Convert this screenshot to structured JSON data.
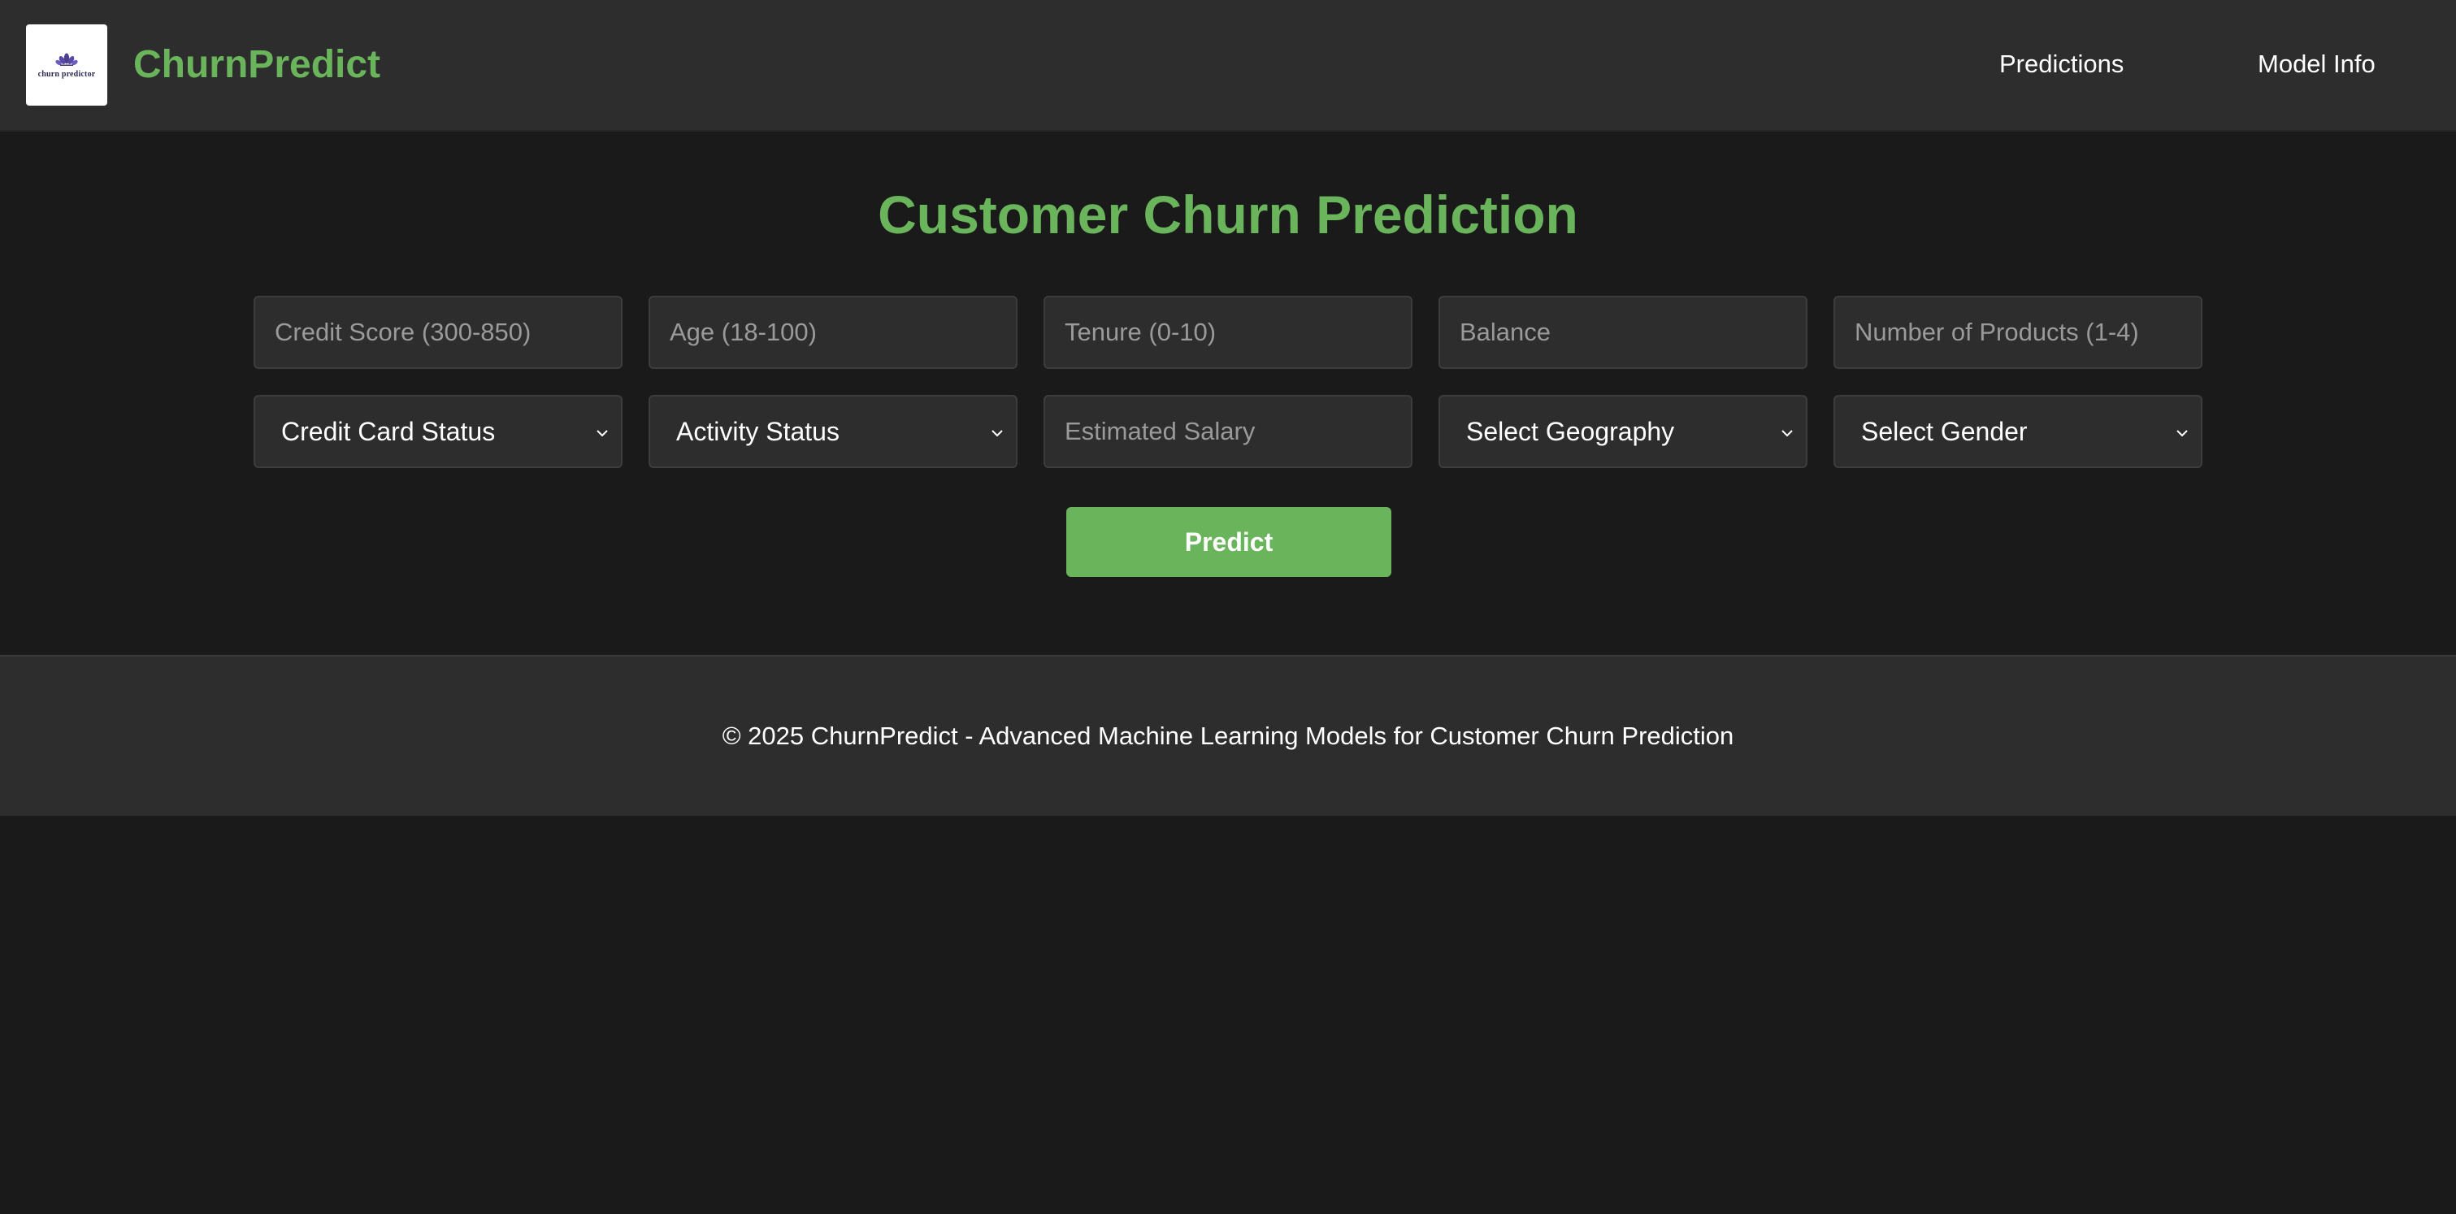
{
  "header": {
    "logo_text": "churn predictor",
    "brand": "ChurnPredict",
    "nav": {
      "predictions": "Predictions",
      "model_info": "Model Info"
    }
  },
  "main": {
    "title": "Customer Churn Prediction",
    "inputs": {
      "credit_score": {
        "placeholder": "Credit Score (300-850)",
        "value": ""
      },
      "age": {
        "placeholder": "Age (18-100)",
        "value": ""
      },
      "tenure": {
        "placeholder": "Tenure (0-10)",
        "value": ""
      },
      "balance": {
        "placeholder": "Balance",
        "value": ""
      },
      "num_products": {
        "placeholder": "Number of Products (1-4)",
        "value": ""
      },
      "estimated_salary": {
        "placeholder": "Estimated Salary",
        "value": ""
      }
    },
    "selects": {
      "credit_card_status": "Credit Card Status",
      "activity_status": "Activity Status",
      "geography": "Select Geography",
      "gender": "Select Gender"
    },
    "predict_label": "Predict"
  },
  "footer": {
    "text": "© 2025 ChurnPredict - Advanced Machine Learning Models for Customer Churn Prediction"
  },
  "colors": {
    "accent": "#6ab45c",
    "background": "#1a1a1a",
    "surface": "#2d2d2d",
    "field_border": "#3c3c3c",
    "placeholder": "#9a9a9a",
    "text": "#ffffff"
  },
  "icons": {
    "logo": "lotus-logo-icon",
    "select_arrow": "chevron-down-icon"
  }
}
